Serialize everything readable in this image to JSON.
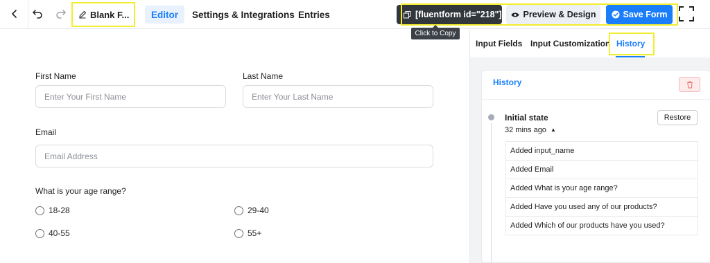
{
  "topbar": {
    "form_title": "Blank F...",
    "tabs": [
      {
        "label": "Editor",
        "active": true
      },
      {
        "label": "Settings & Integrations",
        "active": false
      },
      {
        "label": "Entries",
        "active": false
      }
    ],
    "shortcode": "[fluentform id=\"218\"]",
    "tooltip": "Click to Copy",
    "preview_label": "Preview & Design",
    "save_label": "Save Form"
  },
  "form": {
    "first_name": {
      "label": "First Name",
      "placeholder": "Enter Your First Name"
    },
    "last_name": {
      "label": "Last Name",
      "placeholder": "Enter Your Last Name"
    },
    "email": {
      "label": "Email",
      "placeholder": "Email Address"
    },
    "age": {
      "label": "What is your age range?",
      "options": [
        "18-28",
        "29-40",
        "40-55",
        "55+"
      ]
    }
  },
  "panel": {
    "tabs": [
      {
        "label": "Input Fields",
        "active": false
      },
      {
        "label": "Input Customization",
        "active": false
      },
      {
        "label": "History",
        "active": true
      }
    ],
    "history": {
      "title": "History",
      "state_name": "Initial state",
      "state_time": "32 mins ago",
      "restore_label": "Restore",
      "changes": [
        "Added input_name",
        "Added Email",
        "Added What is your age range?",
        "Added Have you used any of our products?",
        "Added Which of our products have you used?"
      ]
    }
  },
  "colors": {
    "accent": "#1a7efb",
    "highlight": "#f2ed2e",
    "shortcode_bg": "#32373c",
    "danger": "#f56c6c"
  }
}
